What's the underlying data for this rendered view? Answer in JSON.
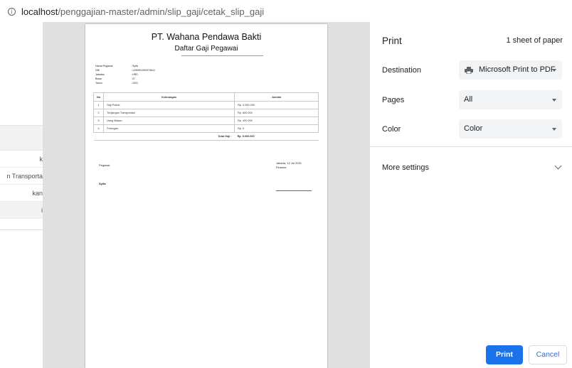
{
  "address_bar": {
    "icon": "info-icon",
    "host": "localhost",
    "path": "/penggajian-master/admin/slip_gaji/cetak_slip_gaji"
  },
  "background_page": {
    "rows": [
      "k",
      "n Transporta",
      "kan",
      "i"
    ]
  },
  "document": {
    "company": "PT. Wahana Pendawa Bakti",
    "subtitle": "Daftar Gaji Pegawai",
    "info": [
      {
        "label": "Nama Pegawai",
        "value": ": Syifa"
      },
      {
        "label": "NIK",
        "value": ": 1290901092974612"
      },
      {
        "label": "Jabatan",
        "value": ": HRD"
      },
      {
        "label": "Bulan",
        "value": ": 07"
      },
      {
        "label": "Tahun",
        "value": ": 2021"
      }
    ],
    "table": {
      "headers": [
        "No",
        "Keterangan",
        "Jumlah"
      ],
      "rows": [
        {
          "no": "1",
          "ket": "Gaji Pokok",
          "jumlah": "Rp. 4.000.000"
        },
        {
          "no": "2",
          "ket": "Tunjangan Transportasi",
          "jumlah": "Rp. 600.000"
        },
        {
          "no": "3",
          "ket": "Uang Makan",
          "jumlah": "Rp. 400.000"
        },
        {
          "no": "4",
          "ket": "Potongan",
          "jumlah": "Rp. 0"
        }
      ],
      "total_label": "Total Gaji :",
      "total_value": "Rp. 5.000.000"
    },
    "sign_left_title": "Pegawai",
    "sign_left_name": "Syifa",
    "sign_right_place_date": "Jakarta, 12 Jul 2021",
    "sign_right_title": "Finance,"
  },
  "print_panel": {
    "title": "Print",
    "sheets": "1 sheet of paper",
    "destination_label": "Destination",
    "destination_value": "Microsoft Print to PDF",
    "destination_icon": "printer-icon",
    "pages_label": "Pages",
    "pages_value": "All",
    "color_label": "Color",
    "color_value": "Color",
    "more_settings": "More settings",
    "print_button": "Print",
    "cancel_button": "Cancel",
    "accent_color": "#1a73e8"
  }
}
